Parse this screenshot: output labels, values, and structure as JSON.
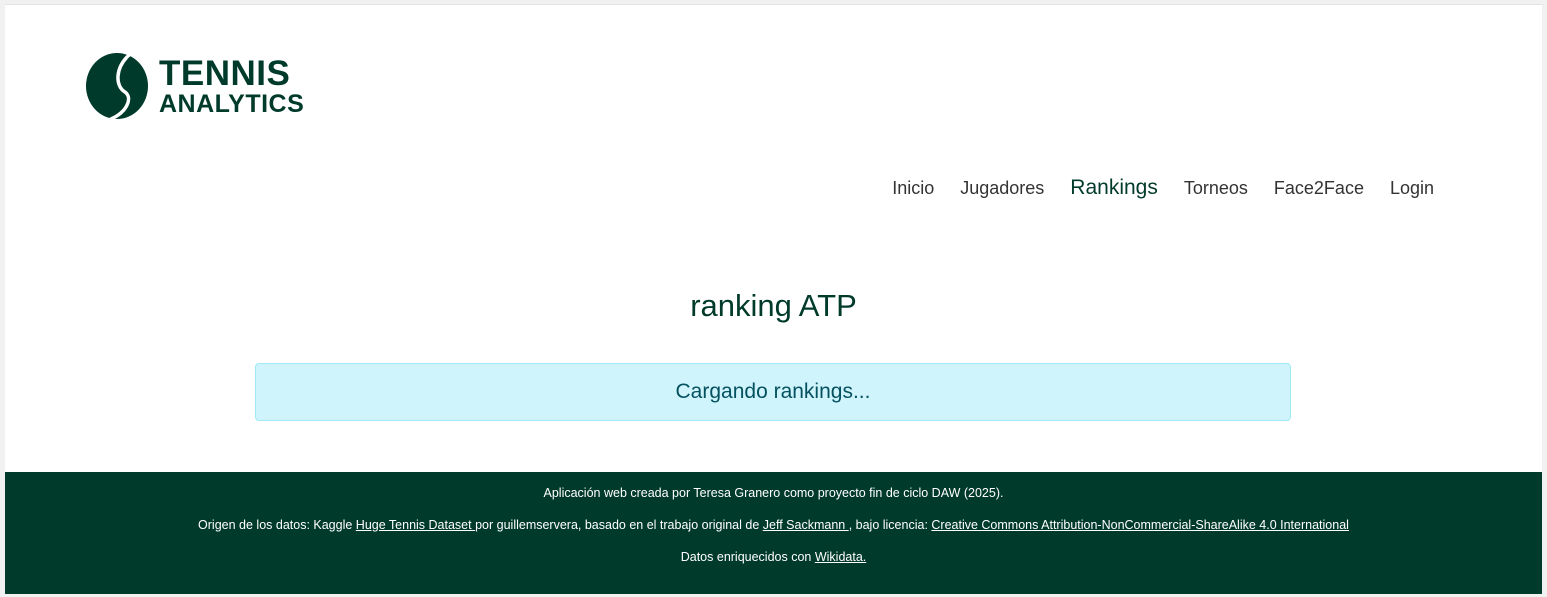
{
  "logo": {
    "line1": "TENNIS",
    "line2": "ANALYTICS"
  },
  "nav": {
    "items": [
      {
        "label": "Inicio"
      },
      {
        "label": "Jugadores"
      },
      {
        "label": "Rankings",
        "active": true
      },
      {
        "label": "Torneos"
      },
      {
        "label": "Face2Face"
      },
      {
        "label": "Login"
      }
    ]
  },
  "main": {
    "title": "ranking ATP",
    "loading_text": "Cargando rankings..."
  },
  "footer": {
    "line1": "Aplicación web creada por Teresa Granero como proyecto fin de ciclo DAW (2025).",
    "line2": {
      "prefix": "Origen de los datos: Kaggle ",
      "link1": "Huge Tennis Dataset ",
      "middle": "por guillemservera, basado en el trabajo original de ",
      "link2": "Jeff Sackmann ",
      "middle2": ", bajo licencia: ",
      "link3": "Creative Commons Attribution-NonCommercial-ShareAlike 4.0 International"
    },
    "line3": {
      "prefix": "Datos enriquecidos con ",
      "link": "Wikidata."
    }
  },
  "colors": {
    "brand": "#003a2a",
    "alert_bg": "#cff4fc",
    "alert_border": "#9eeaf9",
    "alert_text": "#055160"
  }
}
